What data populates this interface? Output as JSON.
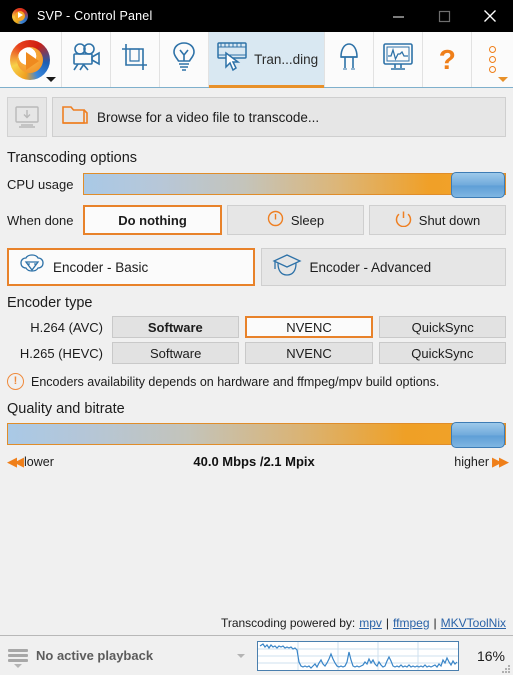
{
  "window": {
    "title": "SVP - Control Panel",
    "logo_icon": "svp-logo-icon",
    "minimize_label": "Minimize",
    "maximize_label": "Maximize",
    "close_label": "Close"
  },
  "toolbar": {
    "items": [
      {
        "name": "svp-main-menu",
        "icon": "svp-logo-icon",
        "label": ""
      },
      {
        "name": "video-profiles",
        "icon": "movie-camera-icon",
        "label": ""
      },
      {
        "name": "crop-frames",
        "icon": "crop-icon",
        "label": ""
      },
      {
        "name": "lightbulb",
        "icon": "lightbulb-icon",
        "label": ""
      },
      {
        "name": "transcoding",
        "icon": "film-strip-cursor-icon",
        "label": "Tran...ding"
      },
      {
        "name": "led-indicator",
        "icon": "led-diode-icon",
        "label": ""
      },
      {
        "name": "performance-monitor",
        "icon": "monitor-waveform-icon",
        "label": ""
      },
      {
        "name": "help",
        "icon": "question-mark-icon",
        "label": "?"
      },
      {
        "name": "more-options",
        "icon": "three-dots-vertical-icon",
        "label": ""
      }
    ],
    "active_tab": "transcoding"
  },
  "browse": {
    "thumb_icon": "video-thumbnail-icon",
    "folder_icon": "folder-icon",
    "button_label": "Browse for a video file to transcode..."
  },
  "transcoding_options": {
    "section_title": "Transcoding options",
    "cpu_usage": {
      "label": "CPU usage",
      "value_percent": 100
    },
    "when_done": {
      "label": "When done",
      "options": [
        {
          "label": "Do nothing",
          "icon": "",
          "selected": true
        },
        {
          "label": "Sleep",
          "icon": "sleep-power-icon",
          "selected": false
        },
        {
          "label": "Shut down",
          "icon": "shutdown-power-icon",
          "selected": false
        }
      ]
    }
  },
  "encoder_tabs": [
    {
      "label": "Encoder - Basic",
      "icon": "sheep-icon",
      "active": true
    },
    {
      "label": "Encoder - Advanced",
      "icon": "graduation-cap-icon",
      "active": false
    }
  ],
  "encoder_type": {
    "section_title": "Encoder type",
    "rows": [
      {
        "label": "H.264 (AVC)",
        "buttons": [
          {
            "label": "Software",
            "state": "selected"
          },
          {
            "label": "NVENC",
            "state": "hover"
          },
          {
            "label": "QuickSync",
            "state": "normal"
          }
        ]
      },
      {
        "label": "H.265 (HEVC)",
        "buttons": [
          {
            "label": "Software",
            "state": "normal"
          },
          {
            "label": "NVENC",
            "state": "normal"
          },
          {
            "label": "QuickSync",
            "state": "normal"
          }
        ]
      }
    ],
    "note": {
      "icon": "warning-exclamation-icon",
      "text": "Encoders availability depends on hardware and ffmpeg/mpv build options."
    }
  },
  "quality": {
    "section_title": "Quality and bitrate",
    "value_percent": 100,
    "lower_label": "lower",
    "higher_label": "higher",
    "lower_icon": "chevron-double-left-icon",
    "higher_icon": "chevron-double-right-icon",
    "value_text": "40.0 Mbps /2.1 Mpix"
  },
  "powered_by": {
    "prefix": "Transcoding powered by:",
    "links": [
      "mpv",
      "ffmpeg",
      "MKVToolNix"
    ],
    "separator": "|"
  },
  "statusbar": {
    "menu_icon": "hamburger-menu-icon",
    "playback_status": "No active playback",
    "dropdown_icon": "caret-down-icon",
    "cpu_graph_name": "cpu-usage-graph",
    "cpu_percent": "16%",
    "resize_grip_icon": "resize-grip-icon"
  },
  "colors": {
    "accent_orange": "#e8822a",
    "icon_blue": "#2e72a8",
    "titlebar_bg": "#000000",
    "window_bg": "#f0f0f0",
    "link_blue": "#2b63a8"
  }
}
